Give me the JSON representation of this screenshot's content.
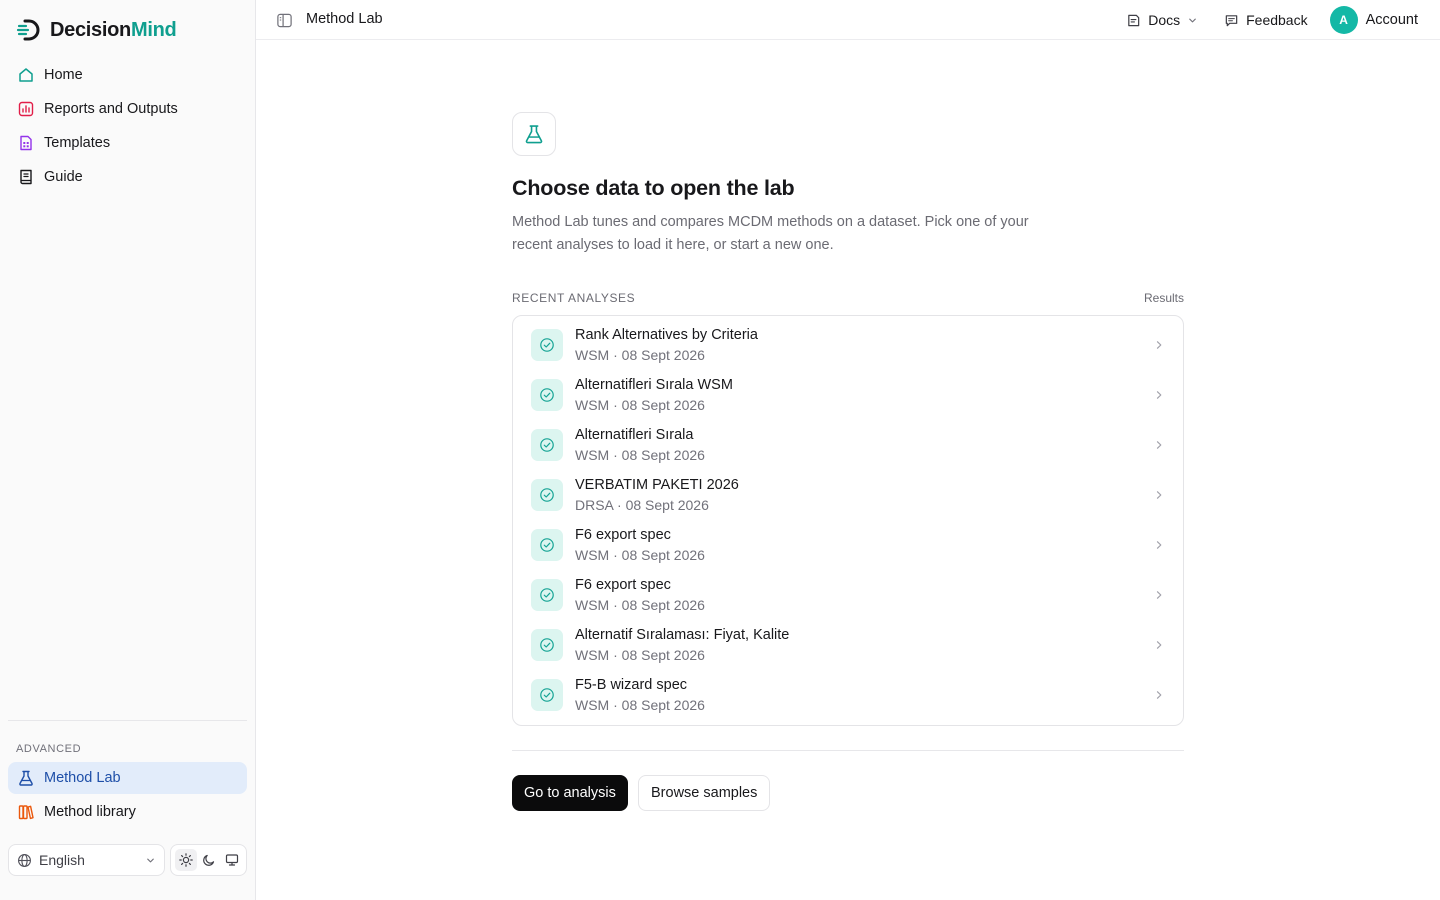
{
  "brand": {
    "name_part1": "Decision",
    "name_part2": "Mind",
    "accent": "#0f9f8f"
  },
  "sidebar": {
    "items": [
      {
        "label": "Home",
        "icon": "home-icon",
        "color": "#0f9f8f"
      },
      {
        "label": "Reports and Outputs",
        "icon": "bar-chart-icon",
        "color": "#e11d48"
      },
      {
        "label": "Templates",
        "icon": "template-icon",
        "color": "#9333ea"
      },
      {
        "label": "Guide",
        "icon": "book-icon",
        "color": "#18181b"
      }
    ],
    "advanced_label": "ADVANCED",
    "advanced_items": [
      {
        "label": "Method Lab",
        "icon": "flask-icon",
        "active": true,
        "color": "#1e4fa8"
      },
      {
        "label": "Method library",
        "icon": "library-icon",
        "color": "#ea580c"
      }
    ],
    "language": {
      "selected": "English"
    },
    "theme": {
      "selected": "light",
      "options": [
        "light",
        "dark",
        "system"
      ]
    }
  },
  "topbar": {
    "title": "Method Lab",
    "docs_label": "Docs",
    "feedback_label": "Feedback",
    "avatar_initial": "A",
    "account_label": "Account"
  },
  "main": {
    "headline": "Choose data to open the lab",
    "description": "Method Lab tunes and compares MCDM methods on a dataset. Pick one of your recent analyses to load it here, or start a new one.",
    "section_label": "RECENT ANALYSES",
    "section_right": "Results",
    "analyses": [
      {
        "name": "Rank Alternatives by Criteria",
        "meta": "WSM · 08 Sept 2026"
      },
      {
        "name": "Alternatifleri Sırala WSM",
        "meta": "WSM · 08 Sept 2026"
      },
      {
        "name": "Alternatifleri Sırala",
        "meta": "WSM · 08 Sept 2026"
      },
      {
        "name": "VERBATIM PAKETI 2026",
        "meta": "DRSA · 08 Sept 2026"
      },
      {
        "name": "F6 export spec",
        "meta": "WSM · 08 Sept 2026"
      },
      {
        "name": "F6 export spec",
        "meta": "WSM · 08 Sept 2026"
      },
      {
        "name": "Alternatif Sıralaması: Fiyat, Kalite",
        "meta": "WSM · 08 Sept 2026"
      },
      {
        "name": "F5-B wizard spec",
        "meta": "WSM · 08 Sept 2026"
      }
    ],
    "primary_button": "Go to analysis",
    "secondary_button": "Browse samples"
  }
}
